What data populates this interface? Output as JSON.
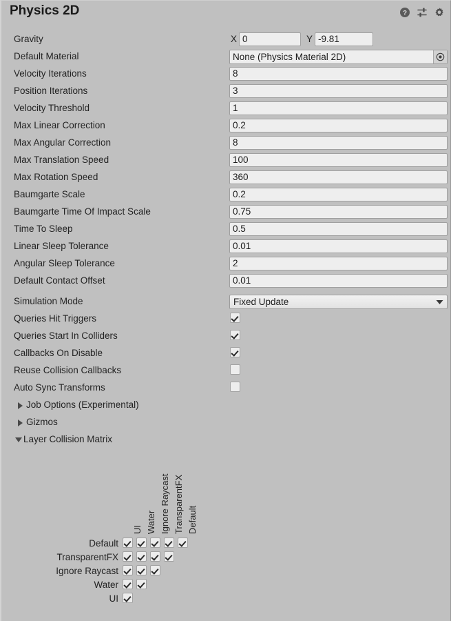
{
  "window": {
    "title": "Physics 2D",
    "background_color": "#c0c0c0",
    "field_color": "#eeeeee"
  },
  "header": {
    "icons": [
      {
        "name": "help-icon",
        "label": "Help"
      },
      {
        "name": "preset-icon",
        "label": "Preset"
      },
      {
        "name": "settings-gear-icon",
        "label": "Settings"
      }
    ]
  },
  "properties": {
    "gravity": {
      "label": "Gravity",
      "x_label": "X",
      "x_value": "0",
      "y_label": "Y",
      "y_value": "-9.81"
    },
    "default_material": {
      "label": "Default Material",
      "value": "None (Physics Material 2D)"
    },
    "numeric_fields": [
      {
        "label": "Velocity Iterations",
        "value": "8"
      },
      {
        "label": "Position Iterations",
        "value": "3"
      },
      {
        "label": "Velocity Threshold",
        "value": "1"
      },
      {
        "label": "Max Linear Correction",
        "value": "0.2"
      },
      {
        "label": "Max Angular Correction",
        "value": "8"
      },
      {
        "label": "Max Translation Speed",
        "value": "100"
      },
      {
        "label": "Max Rotation Speed",
        "value": "360"
      },
      {
        "label": "Baumgarte Scale",
        "value": "0.2"
      },
      {
        "label": "Baumgarte Time Of Impact Scale",
        "value": "0.75"
      },
      {
        "label": "Time To Sleep",
        "value": "0.5"
      },
      {
        "label": "Linear Sleep Tolerance",
        "value": "0.01"
      },
      {
        "label": "Angular Sleep Tolerance",
        "value": "2"
      },
      {
        "label": "Default Contact Offset",
        "value": "0.01"
      }
    ],
    "simulation_mode": {
      "label": "Simulation Mode",
      "value": "Fixed Update"
    },
    "toggles": [
      {
        "label": "Queries Hit Triggers",
        "checked": true
      },
      {
        "label": "Queries Start In Colliders",
        "checked": true
      },
      {
        "label": "Callbacks On Disable",
        "checked": true
      },
      {
        "label": "Reuse Collision Callbacks",
        "checked": false
      },
      {
        "label": "Auto Sync Transforms",
        "checked": false
      }
    ],
    "foldouts": [
      {
        "label": "Job Options (Experimental)",
        "expanded": false
      },
      {
        "label": "Gizmos",
        "expanded": false
      },
      {
        "label": "Layer Collision Matrix",
        "expanded": true
      }
    ]
  },
  "layer_collision_matrix": {
    "column_labels": [
      "UI",
      "Water",
      "Ignore Raycast",
      "TransparentFX",
      "Default"
    ],
    "row_labels": [
      "Default",
      "TransparentFX",
      "Ignore Raycast",
      "Water",
      "UI"
    ],
    "rows": [
      {
        "label": "Default",
        "cells": [
          true,
          true,
          true,
          true,
          true
        ]
      },
      {
        "label": "TransparentFX",
        "cells": [
          true,
          true,
          true,
          true
        ]
      },
      {
        "label": "Ignore Raycast",
        "cells": [
          true,
          true,
          true
        ]
      },
      {
        "label": "Water",
        "cells": [
          true,
          true
        ]
      },
      {
        "label": "UI",
        "cells": [
          true
        ]
      }
    ]
  }
}
